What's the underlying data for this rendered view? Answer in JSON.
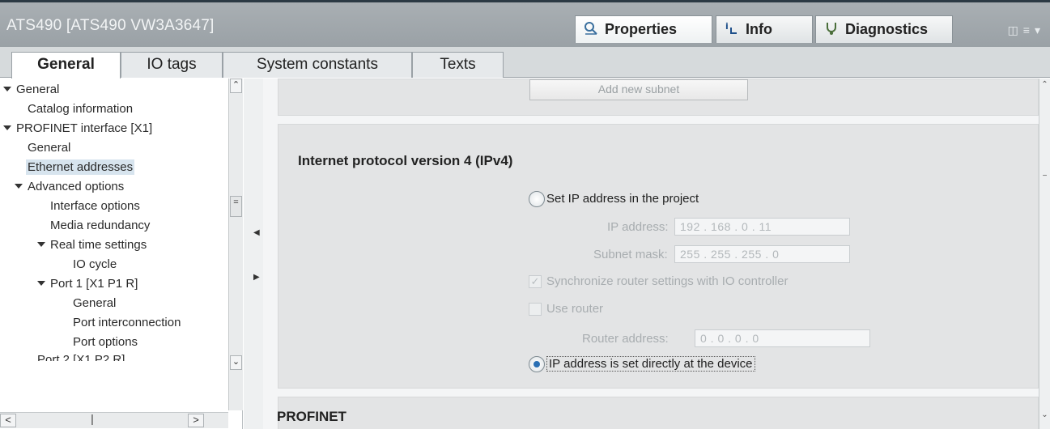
{
  "window": {
    "title": "ATS490 [ATS490 VW3A3647]"
  },
  "inspector_tabs": [
    {
      "label": "Properties",
      "icon": "properties-icon"
    },
    {
      "label": "Info",
      "icon": "info-icon"
    },
    {
      "label": "Diagnostics",
      "icon": "diagnostics-icon"
    }
  ],
  "tabs": [
    "General",
    "IO tags",
    "System constants",
    "Texts"
  ],
  "nav": [
    "General",
    "Catalog information",
    "PROFINET interface [X1]",
    "General",
    "Ethernet addresses",
    "Advanced options",
    "Interface options",
    "Media redundancy",
    "Real time settings",
    "IO cycle",
    "Port 1 [X1 P1 R]",
    "General",
    "Port interconnection",
    "Port options",
    "Port 2 [X1 P2 R]"
  ],
  "content": {
    "add_subnet_label": "Add new subnet",
    "ipv4_title": "Internet protocol version 4 (IPv4)",
    "set_ip_label": "Set IP address in the project",
    "ip_address_label": "IP address:",
    "ip_address_value": "192 . 168 . 0    . 11",
    "subnet_mask_label": "Subnet mask:",
    "subnet_mask_value": "255 . 255 . 255 . 0",
    "sync_router_label": "Synchronize router settings with IO controller",
    "use_router_label": "Use router",
    "router_address_label": "Router address:",
    "router_address_value": "0    . 0    . 0    . 0",
    "ip_direct_label": "IP address is set directly at the device",
    "profinet_title": "PROFINET"
  }
}
